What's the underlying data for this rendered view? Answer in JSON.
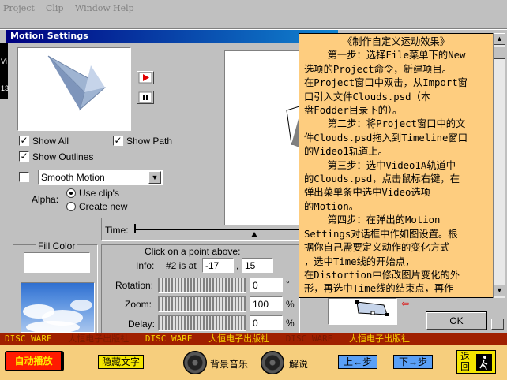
{
  "menu": [
    "Project",
    "Clip",
    "Window",
    "Help"
  ],
  "dialog": {
    "title": "Motion Settings",
    "show_all": "Show All",
    "show_path": "Show Path",
    "show_outlines": "Show Outlines",
    "motion_select": "Smooth Motion",
    "alpha_label": "Alpha:",
    "alpha_options": [
      "Use clip's",
      "Create new"
    ],
    "time_label": "Time:",
    "fill_color": "Fill Color",
    "click_hint": "Click on a point above:",
    "info_label": "Info:",
    "info_point": "#2 is at",
    "info_x": "-17",
    "info_sep": ",",
    "info_y": "15",
    "rotation_label": "Rotation:",
    "rotation_value": "0",
    "rotation_unit": "°",
    "zoom_label": "Zoom:",
    "zoom_value": "100",
    "zoom_unit": "%",
    "delay_label": "Delay:",
    "delay_value": "0",
    "delay_unit": "%",
    "ok": "OK",
    "side_text": "Vi",
    "side_text2": "13"
  },
  "panel": {
    "title": "《制作自定义运动效果》",
    "lines": [
      "    第一步：选择File菜单下的New",
      "选项的Project命令，新建项目。",
      "在Project窗口中双击，从Import窗",
      "口引入文件Clouds.psd（本",
      "盘Fodder目录下的）。",
      "    第二步：将Project窗口中的文",
      "件Clouds.psd拖入到Timeline窗口",
      "的Video1轨道上。",
      "    第三步：选中Video1A轨道中",
      "的Clouds.psd，点击鼠标右键，在",
      "弹出菜单条中选中Video选项",
      "的Motion。",
      "    第四步：在弹出的Motion",
      "Settings对话框中作如图设置。根",
      "据你自己需要定义动作的变化方式",
      "，选中Time线的开始点，",
      "在Distortion中修改图片变化的外",
      "形，再选中Time线的结束点，再作"
    ]
  },
  "banner": [
    "DISC WARE",
    "大恒电子出版社",
    "DISC WARE",
    "大恒电子出版社",
    "DISC WARE",
    "大恒电子出版社"
  ],
  "nav": {
    "autoplay": "自动播放",
    "hide_text": "隐藏文字",
    "bg_music": "背景音乐",
    "narration": "解说",
    "prev": "上←步",
    "next": "下→步",
    "back": "返回"
  },
  "colors": {
    "panel_bg": "#fecd7f",
    "banner_bg": "#a02000",
    "nav_bg": "#f6ce7d",
    "button_yellow": "#f4e600",
    "button_blue": "#5aa0f6",
    "autoplay_red": "#ff1a00"
  }
}
